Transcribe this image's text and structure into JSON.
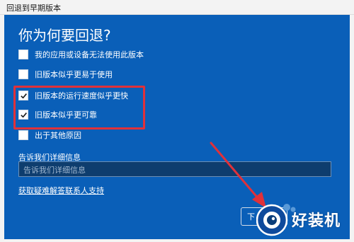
{
  "window": {
    "title": "回退到早期版本"
  },
  "page": {
    "heading": "你为何要回退?"
  },
  "options": [
    {
      "label": "我的应用或设备无法使用此版本",
      "checked": false
    },
    {
      "label": "旧版本似乎更易于使用",
      "checked": false
    },
    {
      "label": "旧版本的运行速度似乎更快",
      "checked": true
    },
    {
      "label": "旧版本似乎更可靠",
      "checked": true
    },
    {
      "label": "出于其他原因",
      "checked": false
    }
  ],
  "details": {
    "label": "告诉我们详细信息",
    "placeholder": "告诉我们详细信息",
    "value": ""
  },
  "help_link": "获取疑难解答联系人支持",
  "next_button": {
    "label": "下"
  },
  "watermark": {
    "text": "好装机"
  },
  "colors": {
    "panel": "#0a5fb8",
    "highlight": "#e0313a",
    "field": "#0e3d6e"
  }
}
